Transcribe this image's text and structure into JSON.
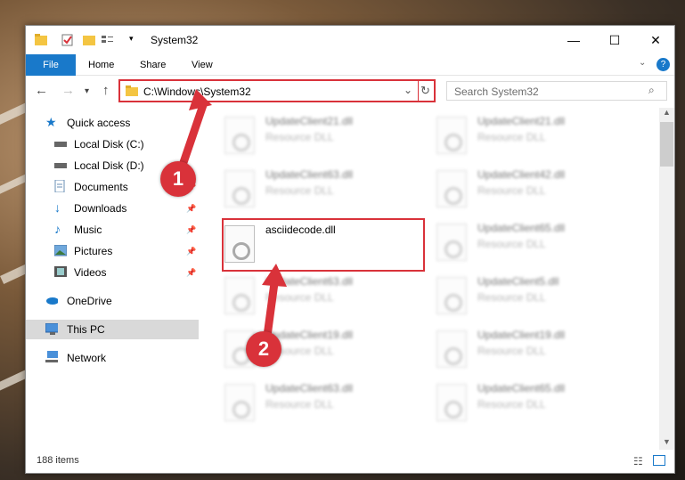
{
  "window": {
    "title": "System32",
    "controls": {
      "minimize": "—",
      "maximize": "☐",
      "close": "✕"
    }
  },
  "ribbon": {
    "file_tab": "File",
    "tabs": [
      "Home",
      "Share",
      "View"
    ],
    "help_icon": "?"
  },
  "address": {
    "path": "C:\\Windows\\System32",
    "search_placeholder": "Search System32"
  },
  "nav": {
    "items": [
      {
        "label": "Quick access",
        "icon": "star-icon"
      },
      {
        "label": "Local Disk (C:)",
        "icon": "drive-icon"
      },
      {
        "label": "Local Disk (D:)",
        "icon": "drive-icon"
      },
      {
        "label": "Documents",
        "icon": "documents-icon",
        "pinned": true
      },
      {
        "label": "Downloads",
        "icon": "download-icon",
        "pinned": true
      },
      {
        "label": "Music",
        "icon": "music-icon",
        "pinned": true
      },
      {
        "label": "Pictures",
        "icon": "pictures-icon",
        "pinned": true
      },
      {
        "label": "Videos",
        "icon": "videos-icon",
        "pinned": true
      },
      {
        "label": "OneDrive",
        "icon": "cloud-icon"
      },
      {
        "label": "This PC",
        "icon": "computer-icon",
        "selected": true
      },
      {
        "label": "Network",
        "icon": "network-icon"
      }
    ]
  },
  "files": {
    "left": [
      {
        "name": "UpdateClient21.dll",
        "type": "Resource DLL"
      },
      {
        "name": "UpdateClient63.dll",
        "type": "Resource DLL"
      },
      {
        "name": "asciidecode.dll",
        "type": ""
      },
      {
        "name": "UpdateClient63.dll",
        "type": "Resource DLL"
      },
      {
        "name": "UpdateClient19.dll",
        "type": "Resource DLL"
      },
      {
        "name": "UpdateClient63.dll",
        "type": "Resource DLL"
      }
    ],
    "right": [
      {
        "name": "UpdateClient21.dll",
        "type": "Resource DLL"
      },
      {
        "name": "UpdateClient42.dll",
        "type": "Resource DLL"
      },
      {
        "name": "UpdateClient65.dll",
        "type": "Resource DLL"
      },
      {
        "name": "UpdateClient5.dll",
        "type": "Resource DLL"
      },
      {
        "name": "UpdateClient19.dll",
        "type": "Resource DLL"
      },
      {
        "name": "UpdateClient65.dll",
        "type": "Resource DLL"
      }
    ]
  },
  "status": {
    "item_count": "188 items"
  },
  "callouts": [
    "1",
    "2"
  ],
  "colors": {
    "accent": "#1979ca",
    "highlight": "#d9323a"
  }
}
